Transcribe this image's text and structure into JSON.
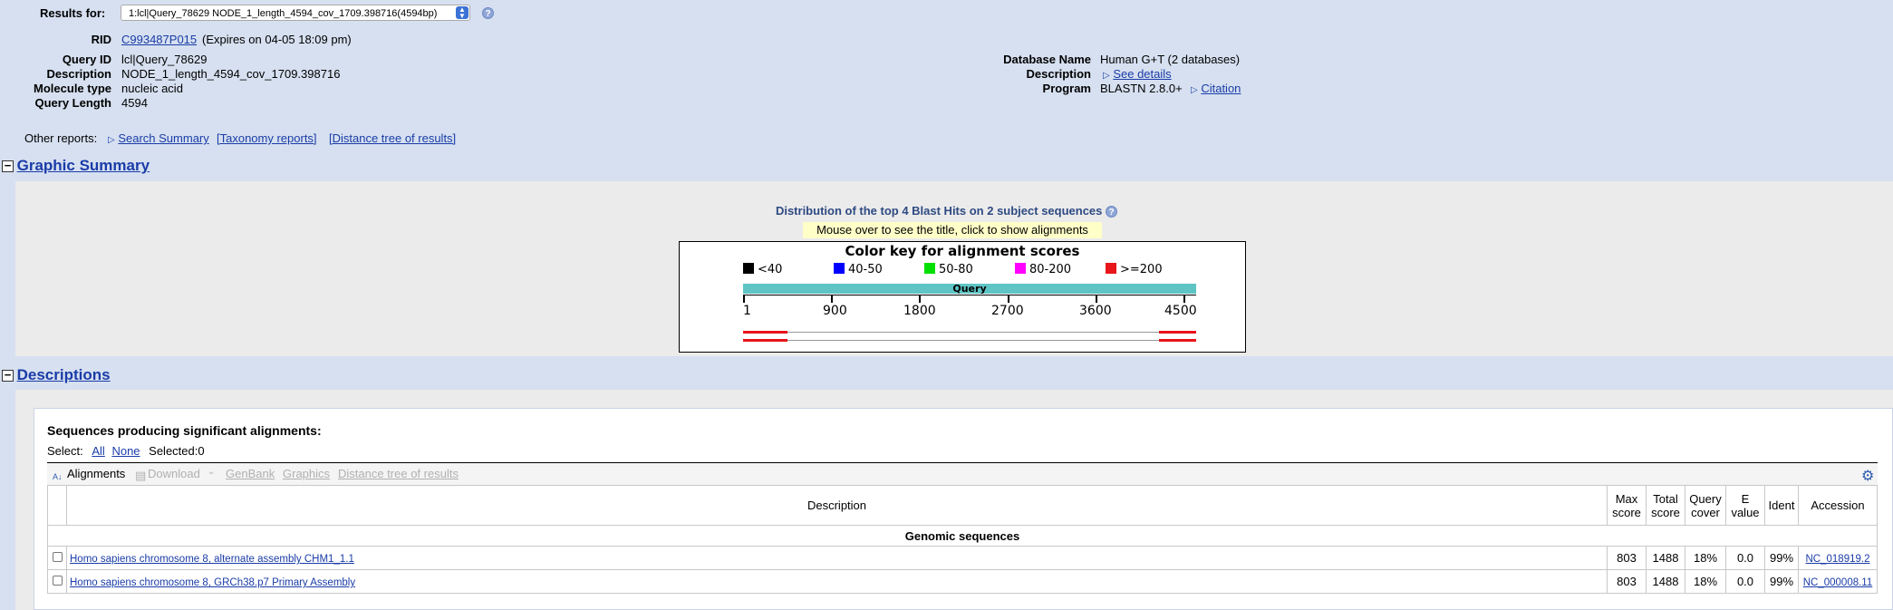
{
  "header": {
    "results_for_label": "Results for:",
    "results_select_value": "1:lcl|Query_78629 NODE_1_length_4594_cov_1709.398716(4594bp)",
    "help_glyph": "?"
  },
  "rid": {
    "label": "RID",
    "value": "C993487P015",
    "expires": "(Expires on 04-05 18:09 pm)"
  },
  "query": {
    "id_label": "Query ID",
    "id_value": "lcl|Query_78629",
    "desc_label": "Description",
    "desc_value": "NODE_1_length_4594_cov_1709.398716",
    "moltype_label": "Molecule type",
    "moltype_value": "nucleic acid",
    "length_label": "Query Length",
    "length_value": "4594"
  },
  "database": {
    "name_label": "Database Name",
    "name_value": "Human G+T (2 databases)",
    "desc_label": "Description",
    "desc_link": "See details",
    "program_label": "Program",
    "program_value": "BLASTN 2.8.0+",
    "citation_link": "Citation"
  },
  "other_reports": {
    "label": "Other reports:",
    "search_summary": "Search Summary",
    "taxonomy": "[Taxonomy reports]",
    "distance_tree": "[Distance tree of results]"
  },
  "graphic_summary": {
    "title": "Graphic Summary",
    "distribution_title": "Distribution of the top 4 Blast Hits on 2 subject sequences",
    "mouse_note": "Mouse over to see the title, click to show alignments",
    "key_title": "Color key for alignment scores",
    "key": [
      {
        "label": "<40",
        "color": "#000000"
      },
      {
        "label": "40-50",
        "color": "#0000ff"
      },
      {
        "label": "50-80",
        "color": "#00e000"
      },
      {
        "label": "80-200",
        "color": "#ff00ff"
      },
      {
        "label": ">=200",
        "color": "#e8151b"
      }
    ],
    "query_label": "Query",
    "ticks": [
      "1",
      "900",
      "1800",
      "2700",
      "3600",
      "4500"
    ]
  },
  "descriptions": {
    "title": "Descriptions",
    "seq_heading": "Sequences producing significant alignments:",
    "select_label": "Select:",
    "select_all": "All",
    "select_none": "None",
    "selected_count": "Selected:0",
    "toolbar": {
      "alignments": "Alignments",
      "download": "Download",
      "genbank": "GenBank",
      "graphics": "Graphics",
      "distance_tree": "Distance tree of results"
    },
    "columns": {
      "description": "Description",
      "max_score": "Max score",
      "total_score": "Total score",
      "query_cover": "Query cover",
      "e_value": "E value",
      "ident": "Ident",
      "accession": "Accession"
    },
    "group_label": "Genomic sequences",
    "rows": [
      {
        "description": "Homo sapiens chromosome 8, alternate assembly CHM1_1.1",
        "max_score": "803",
        "total_score": "1488",
        "query_cover": "18%",
        "e_value": "0.0",
        "ident": "99%",
        "accession": "NC_018919.2"
      },
      {
        "description": "Homo sapiens chromosome 8, GRCh38.p7 Primary Assembly",
        "max_score": "803",
        "total_score": "1488",
        "query_cover": "18%",
        "e_value": "0.0",
        "ident": "99%",
        "accession": "NC_000008.11"
      }
    ]
  }
}
